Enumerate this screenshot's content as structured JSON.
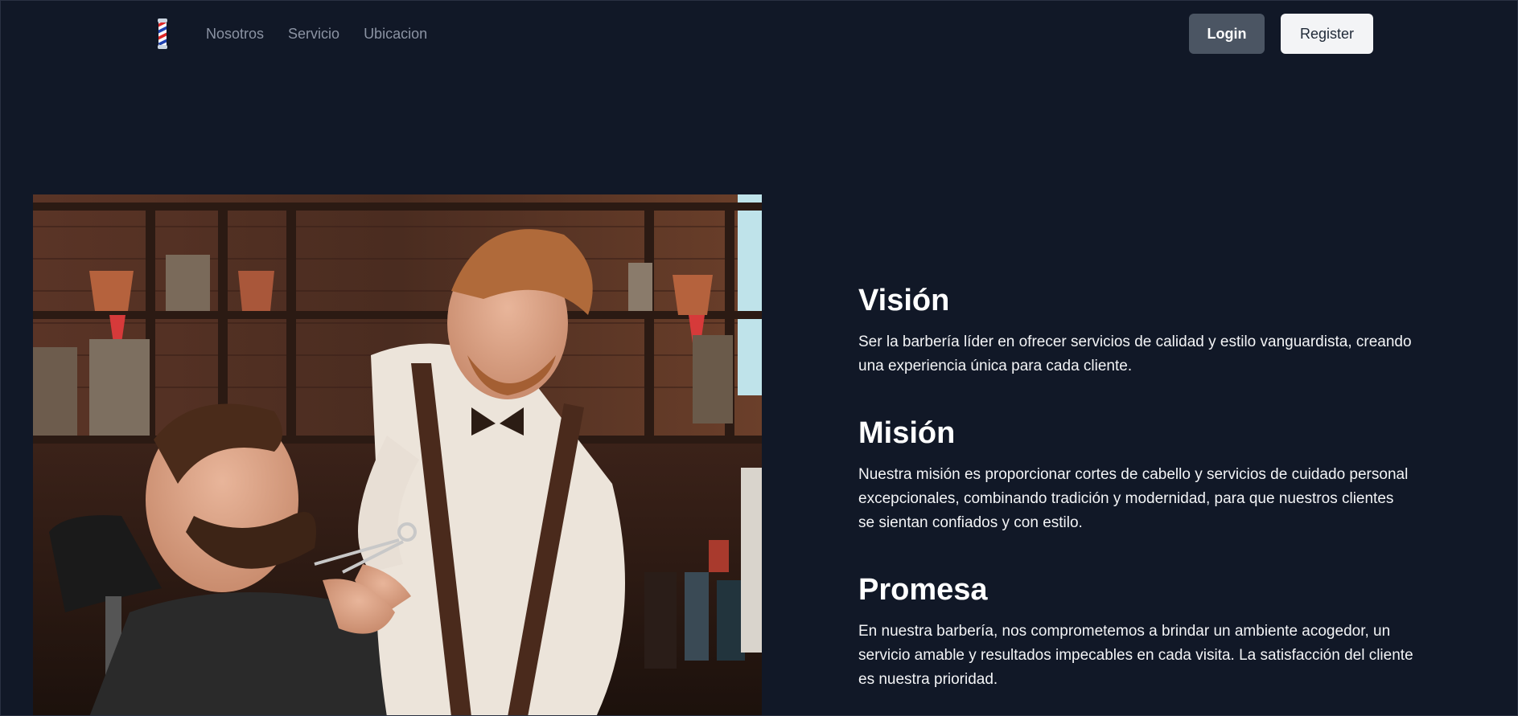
{
  "nav": {
    "logo_icon": "barber-pole-icon",
    "links": [
      "Nosotros",
      "Servicio",
      "Ubicacion"
    ],
    "login_label": "Login",
    "register_label": "Register"
  },
  "hero": {
    "image": "barber-trimming-beard-photo"
  },
  "sections": [
    {
      "title": "Visión",
      "text": "Ser la barbería líder en ofrecer servicios de calidad y estilo vanguardista, creando una experiencia única para cada cliente."
    },
    {
      "title": "Misión",
      "text": "Nuestra misión es proporcionar cortes de cabello y servicios de cuidado personal excepcionales, combinando tradición y modernidad, para que nuestros clientes se sientan confiados y con estilo."
    },
    {
      "title": "Promesa",
      "text": "En nuestra barbería, nos comprometemos a brindar un ambiente acogedor, un servicio amable y resultados impecables en cada visita. La satisfacción del cliente es nuestra prioridad."
    }
  ],
  "colors": {
    "background": "#111827",
    "login_bg": "#4b5563",
    "register_bg": "#f3f4f6",
    "nav_link": "#8b93a3"
  }
}
